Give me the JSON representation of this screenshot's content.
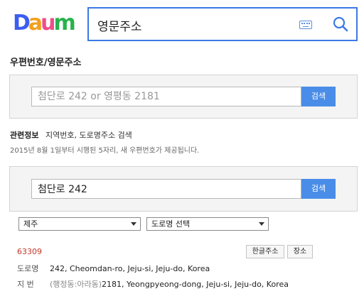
{
  "header": {
    "logo_letters": [
      "D",
      "a",
      "u",
      "m"
    ],
    "search_value": "영문주소"
  },
  "section_title": "우편번호/영문주소",
  "panel1": {
    "placeholder": "첨단로 242 or 영평동 2181",
    "button": "검색"
  },
  "related": {
    "label": "관련정보",
    "link1": "지역번호,",
    "link2": "도로명주소 검색"
  },
  "notice": "2015년 8월 1일부터 시행된 5자리, 새 우편번호가 제공됩니다.",
  "panel2": {
    "value": "첨단로 242",
    "button": "검색"
  },
  "selects": {
    "region": "제주",
    "road": "도로명 선택"
  },
  "result": {
    "zipcode": "63309",
    "btn_korean": "한글주소",
    "btn_place": "장소",
    "road_label": "도로명",
    "road_value": "242, Cheomdan-ro, Jeju-si, Jeju-do, Korea",
    "lot_label": "지 번",
    "lot_sub": "(행정동:아라동)",
    "lot_value": "2181, Yeongpyeong-dong, Jeju-si, Jeju-do, Korea"
  },
  "colors": {
    "accent": "#3c79e6",
    "button": "#4a8de8",
    "zipcode": "#c0392b"
  },
  "icons": [
    "keyboard-icon",
    "search-icon",
    "chevron-down-icon"
  ]
}
